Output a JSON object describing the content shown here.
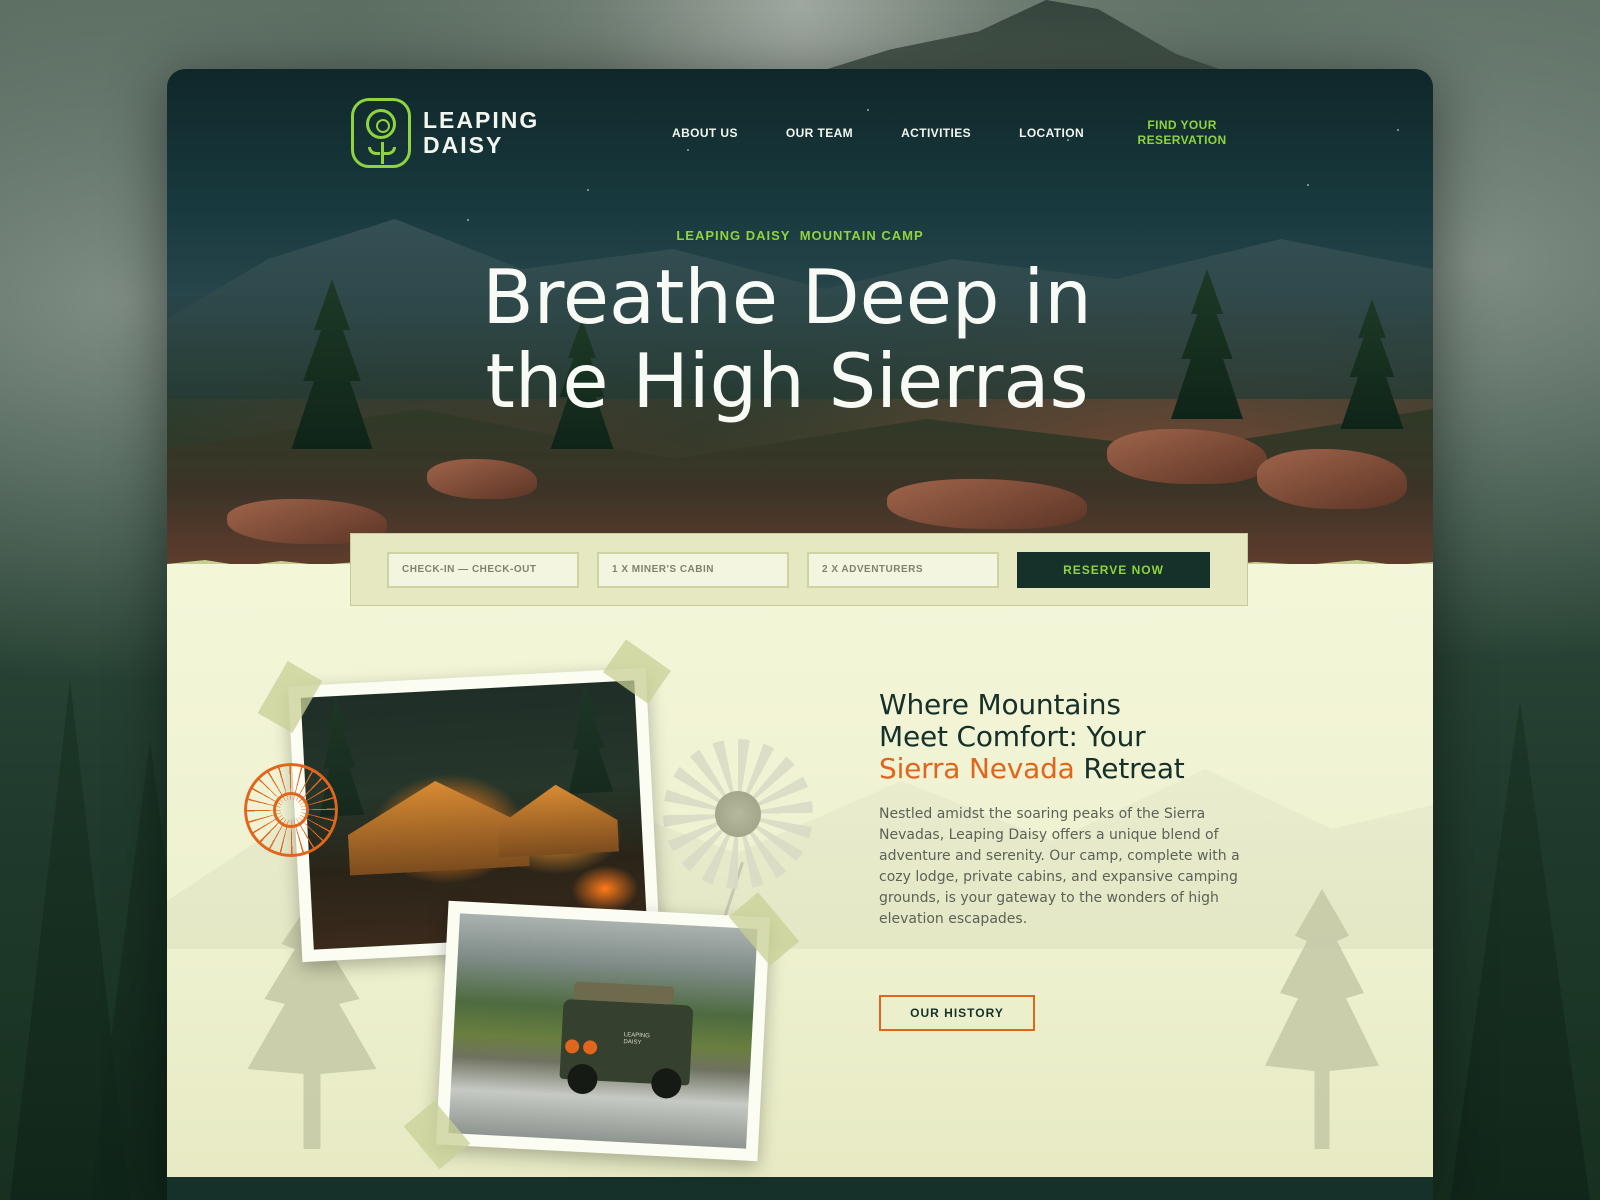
{
  "brand": {
    "name_line1": "LEAPING",
    "name_line2": "DAISY",
    "accent_color": "#8fd43e",
    "orange_color": "#e0661e",
    "dark_color": "#16302a"
  },
  "nav": {
    "items": [
      {
        "label": "ABOUT US"
      },
      {
        "label": "OUR TEAM"
      },
      {
        "label": "ACTIVITIES"
      },
      {
        "label": "LOCATION"
      }
    ],
    "cta_label": "FIND YOUR RESERVATION"
  },
  "hero": {
    "eyebrow_part1": "LEAPING DAISY",
    "eyebrow_part2": "MOUNTAIN CAMP",
    "title_line1": "Breathe Deep in",
    "title_line2": "the High Sierras"
  },
  "booking": {
    "dates_value": "CHECK-IN — CHECK-OUT",
    "cabin_value": "1 X MINER'S CABIN",
    "guests_value": "2 X ADVENTURERS",
    "reserve_label": "RESERVE NOW"
  },
  "about": {
    "heading_line1": "Where Mountains",
    "heading_line2": "Meet Comfort: Your",
    "heading_accent": "Sierra Nevada",
    "heading_end": "Retreat",
    "body": "Nestled amidst the soaring peaks of the Sierra Nevadas, Leaping Daisy offers a unique blend of adventure and serenity. Our camp, complete with a cozy lodge, private cabins, and expansive camping grounds, is your gateway to the wonders of high elevation escapades.",
    "button_label": "OUR HISTORY"
  },
  "photos": {
    "jeep_door_text": "LEAPING DAISY"
  }
}
